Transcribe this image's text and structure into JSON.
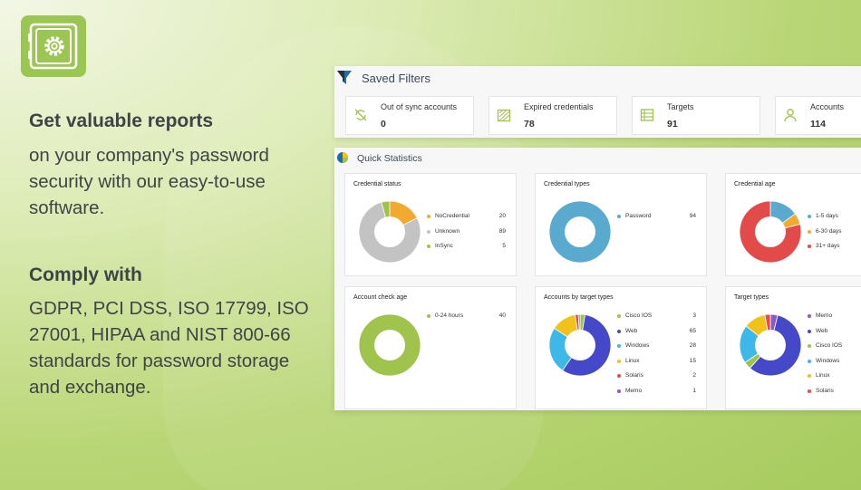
{
  "marketing": {
    "heading1": "Get valuable reports",
    "body1_lines": [
      "on your company's password",
      "security with our easy-to-use",
      "software."
    ],
    "heading2": "Comply with",
    "body2_lines": [
      "GDPR, PCI DSS, ISO 17799, ISO",
      "27001, HIPAA and NIST 800-66",
      "standards for password storage",
      "and exchange."
    ]
  },
  "icons": {
    "logo": "vault-gear-icon",
    "filters": "funnel-icon",
    "stats": "pie-chart-icon"
  },
  "colors": {
    "logo_bg": "#9bc653",
    "orange": "#f2a930",
    "gray": "#c3c3c3",
    "green": "#9fc34c",
    "blue": "#5aa9cf",
    "red": "#e24b4a",
    "navy": "#4548c9",
    "cyan": "#3db8e8",
    "purple": "#8b5bbf"
  },
  "saved_filters": {
    "title": "Saved Filters",
    "cards": [
      {
        "label": "Out of sync accounts",
        "value": "0",
        "icon": "sync-off-icon"
      },
      {
        "label": "Expired credentials",
        "value": "78",
        "icon": "expired-icon"
      },
      {
        "label": "Targets",
        "value": "91",
        "icon": "list-icon"
      },
      {
        "label": "Accounts",
        "value": "114",
        "icon": "user-icon"
      }
    ]
  },
  "quick_statistics": {
    "title": "Quick Statistics",
    "widgets": [
      {
        "title": "Credential status",
        "items": [
          {
            "label": "NoCredential",
            "value": "20",
            "color": "#f2a930"
          },
          {
            "label": "Unknown",
            "value": "89",
            "color": "#c3c3c3"
          },
          {
            "label": "InSync",
            "value": "5",
            "color": "#9fc34c"
          }
        ]
      },
      {
        "title": "Credential types",
        "items": [
          {
            "label": "Password",
            "value": "94",
            "color": "#5aa9cf"
          }
        ]
      },
      {
        "title": "Credential age",
        "items": [
          {
            "label": "1-5 days",
            "value": "",
            "color": "#5aa9cf"
          },
          {
            "label": "6-30 days",
            "value": "",
            "color": "#f2a930"
          },
          {
            "label": "31+ days",
            "value": "",
            "color": "#e24b4a"
          }
        ]
      },
      {
        "title": "Account check age",
        "items": [
          {
            "label": "0-24 hours",
            "value": "40",
            "color": "#9fc34c"
          }
        ]
      },
      {
        "title": "Accounts by target types",
        "items": [
          {
            "label": "Cisco IOS",
            "value": "3",
            "color": "#9fc34c"
          },
          {
            "label": "Web",
            "value": "65",
            "color": "#4548c9"
          },
          {
            "label": "Windows",
            "value": "28",
            "color": "#3db8e8"
          },
          {
            "label": "Linux",
            "value": "15",
            "color": "#f2c21a"
          },
          {
            "label": "Solaris",
            "value": "2",
            "color": "#e24b4a"
          },
          {
            "label": "Memo",
            "value": "1",
            "color": "#8b5bbf"
          }
        ]
      },
      {
        "title": "Target types",
        "items": [
          {
            "label": "Memo",
            "value": "",
            "color": "#8b5bbf"
          },
          {
            "label": "Web",
            "value": "",
            "color": "#4548c9"
          },
          {
            "label": "Cisco IOS",
            "value": "",
            "color": "#9fc34c"
          },
          {
            "label": "Windows",
            "value": "",
            "color": "#3db8e8"
          },
          {
            "label": "Linux",
            "value": "",
            "color": "#f2c21a"
          },
          {
            "label": "Solaris",
            "value": "",
            "color": "#e24b4a"
          }
        ]
      }
    ]
  },
  "chart_data": [
    {
      "type": "pie",
      "title": "Credential status",
      "categories": [
        "NoCredential",
        "Unknown",
        "InSync"
      ],
      "values": [
        20,
        89,
        5
      ],
      "donut": true,
      "legend": "right"
    },
    {
      "type": "pie",
      "title": "Credential types",
      "categories": [
        "Password"
      ],
      "values": [
        94
      ],
      "donut": true,
      "legend": "right"
    },
    {
      "type": "pie",
      "title": "Credential age",
      "categories": [
        "1-5 days",
        "6-30 days",
        "31+ days"
      ],
      "values": [
        15,
        6,
        79
      ],
      "donut": true,
      "legend": "right"
    },
    {
      "type": "pie",
      "title": "Account check age",
      "categories": [
        "0-24 hours"
      ],
      "values": [
        40
      ],
      "donut": true,
      "legend": "right"
    },
    {
      "type": "pie",
      "title": "Accounts by target types",
      "categories": [
        "Cisco IOS",
        "Web",
        "Windows",
        "Linux",
        "Solaris",
        "Memo"
      ],
      "values": [
        3,
        65,
        28,
        15,
        2,
        1
      ],
      "donut": true,
      "legend": "right"
    },
    {
      "type": "pie",
      "title": "Target types",
      "categories": [
        "Memo",
        "Web",
        "Cisco IOS",
        "Windows",
        "Linux",
        "Solaris"
      ],
      "values": [
        4,
        60,
        4,
        21,
        12,
        3
      ],
      "donut": true,
      "legend": "right"
    }
  ]
}
